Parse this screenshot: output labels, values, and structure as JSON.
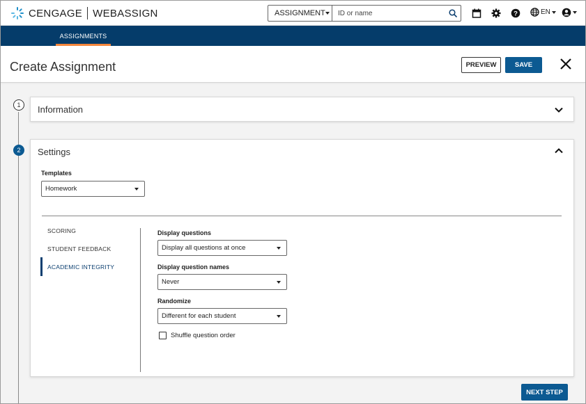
{
  "brand": {
    "name": "CENGAGE",
    "product": "WEBASSIGN"
  },
  "search": {
    "type_label": "ASSIGNMENT",
    "placeholder": "ID or name"
  },
  "header_icons": [
    "calendar-icon",
    "gear-icon",
    "help-icon",
    "globe-icon",
    "account-icon"
  ],
  "language": {
    "label": "EN"
  },
  "nav": {
    "tabs": [
      {
        "label": "ASSIGNMENTS",
        "active": true
      }
    ]
  },
  "page": {
    "title": "Create Assignment"
  },
  "toolbar": {
    "preview_label": "PREVIEW",
    "save_label": "SAVE"
  },
  "steps": [
    {
      "number": "1",
      "title": "Information",
      "expanded": false
    },
    {
      "number": "2",
      "title": "Settings",
      "expanded": true
    }
  ],
  "settings": {
    "templates_label": "Templates",
    "templates_value": "Homework",
    "subnav": [
      {
        "label": "SCORING",
        "active": false
      },
      {
        "label": "STUDENT FEEDBACK",
        "active": false
      },
      {
        "label": "ACADEMIC INTEGRITY",
        "active": true
      }
    ],
    "fields": [
      {
        "label": "Display questions",
        "value": "Display all questions at once"
      },
      {
        "label": "Display question names",
        "value": "Never"
      },
      {
        "label": "Randomize",
        "value": "Different for each student"
      }
    ],
    "shuffle_label": "Shuffle question order",
    "shuffle_checked": false
  },
  "footer": {
    "next_label": "NEXT STEP"
  },
  "colors": {
    "primary": "#0c5a92",
    "nav_bg": "#053c6a",
    "nav_accent": "#f5873c",
    "active_text": "#0c3f70"
  }
}
